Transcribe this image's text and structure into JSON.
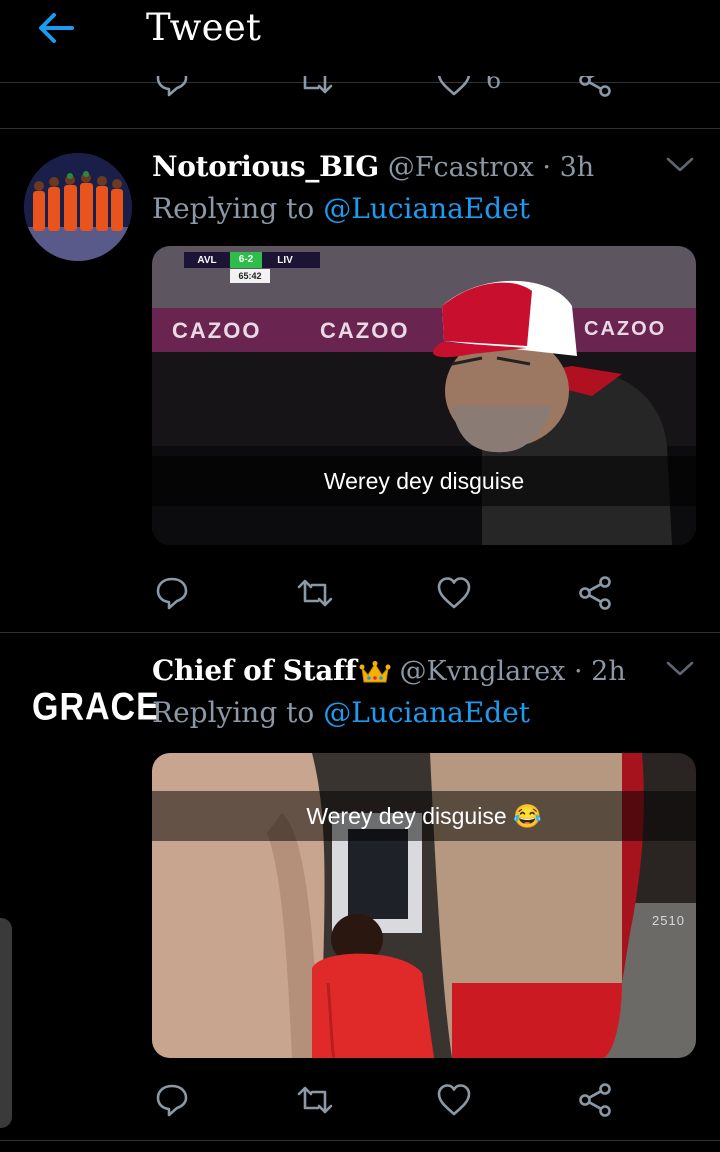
{
  "header": {
    "title": "Tweet",
    "back_icon": "arrow-left-icon",
    "accent": "#1d9bf0"
  },
  "prev_tweet_actions": {
    "like_count": "6"
  },
  "tweets": [
    {
      "author_name": "Notorious_BIG",
      "handle": "@Fcastrox",
      "time": "3h",
      "replying_prefix": "Replying to",
      "replying_to": "@LucianaEdet",
      "media": {
        "scoreboard": {
          "home": "AVL",
          "score": "6-2",
          "away": "LIV",
          "clock": "65:42"
        },
        "board_text": [
          "CAZOO",
          "CAZOO",
          "CAZOO"
        ],
        "caption": "Werey dey disguise"
      }
    },
    {
      "author_name": "Chief of Staff",
      "author_badge": "crown-icon",
      "handle": "@Kvnglarex",
      "time": "2h",
      "replying_prefix": "Replying to",
      "replying_to": "@LucianaEdet",
      "avatar_text": "GRACE",
      "media": {
        "caption": "Werey dey disguise 😂",
        "sign_text": "2510"
      }
    }
  ]
}
